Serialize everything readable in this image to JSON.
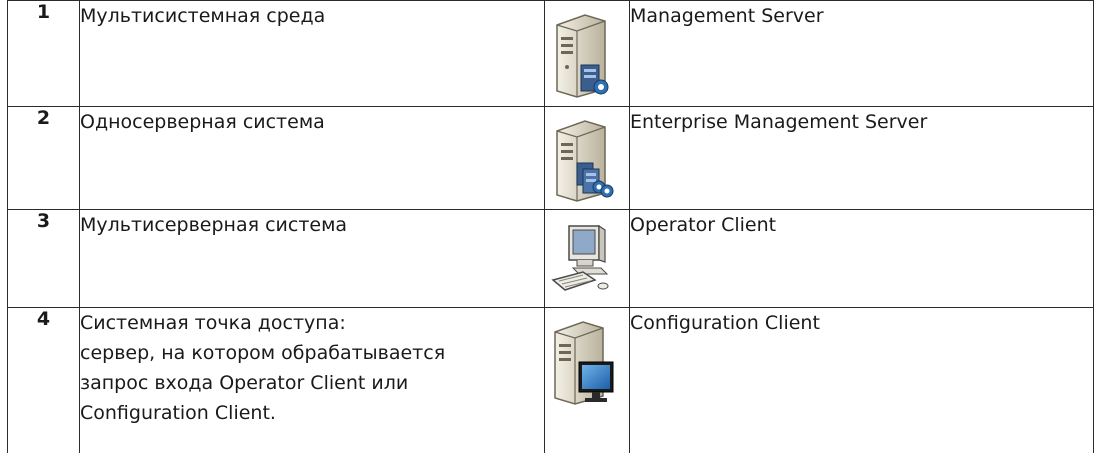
{
  "rows": [
    {
      "number": "1",
      "description_lines": [
        "Мультисистемная среда"
      ],
      "icon": "management-server-icon",
      "label": "Management Server"
    },
    {
      "number": "2",
      "description_lines": [
        "Односерверная система"
      ],
      "icon": "enterprise-management-server-icon",
      "label": "Enterprise Management Server"
    },
    {
      "number": "3",
      "description_lines": [
        "Мультисерверная система"
      ],
      "icon": "operator-client-icon",
      "label": "Operator Client"
    },
    {
      "number": "4",
      "description_lines": [
        "Системная точка доступа:",
        "сервер, на котором обрабатывается",
        "запрос входа Operator Client или",
        "Configuration Client."
      ],
      "icon": "configuration-client-icon",
      "label": "Configuration Client"
    }
  ],
  "colors": {
    "border": "#2b2b2b",
    "server_body": "#d9d4c4",
    "accent_blue": "#2f6fb3"
  }
}
